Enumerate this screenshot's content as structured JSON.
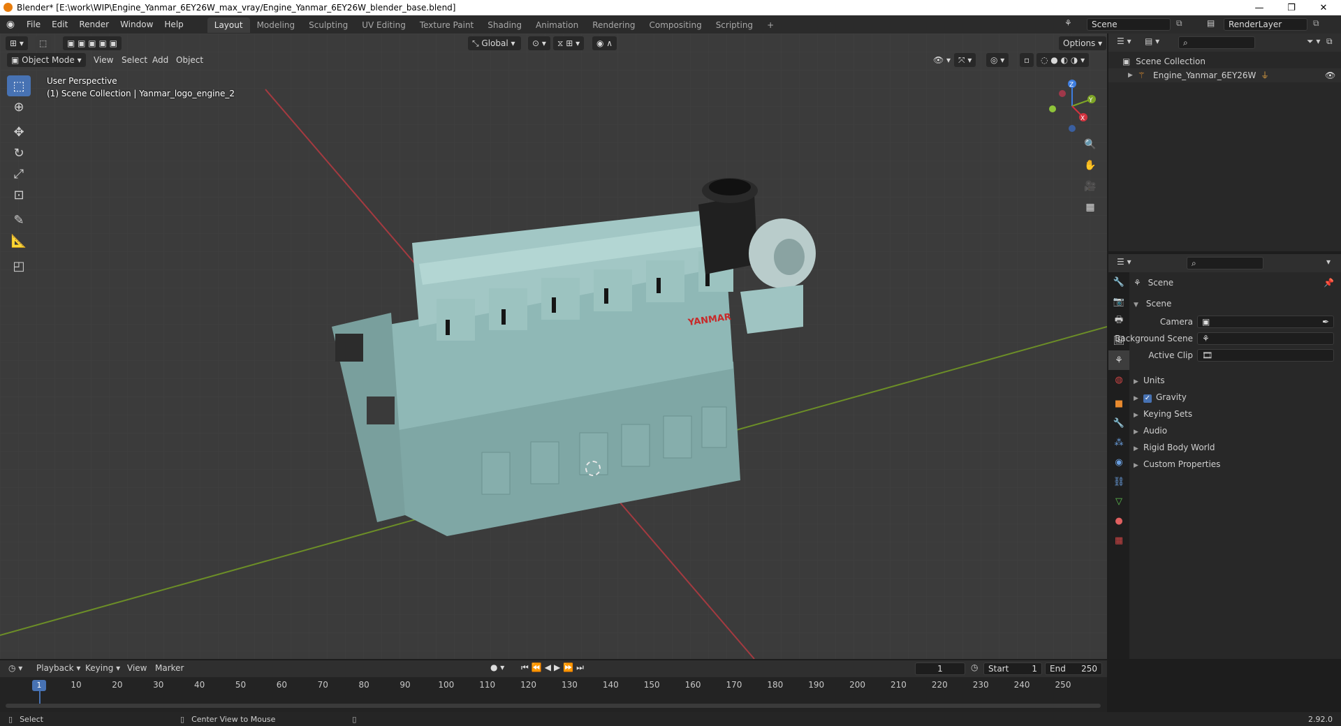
{
  "window": {
    "title": "Blender* [E:\\work\\WIP\\Engine_Yanmar_6EY26W_max_vray/Engine_Yanmar_6EY26W_blender_base.blend]",
    "minimize": "—",
    "restore": "❐",
    "close": "✕"
  },
  "menubar": {
    "items": [
      "File",
      "Edit",
      "Render",
      "Window",
      "Help"
    ],
    "workspaces": [
      "Layout",
      "Modeling",
      "Sculpting",
      "UV Editing",
      "Texture Paint",
      "Shading",
      "Animation",
      "Rendering",
      "Compositing",
      "Scripting"
    ],
    "add_workspace": "+",
    "scene": "Scene",
    "renderlayer": "RenderLayer"
  },
  "viewport": {
    "orientation": "Global",
    "options": "Options",
    "mode": "Object Mode",
    "menus": [
      "View",
      "Select",
      "Add",
      "Object"
    ],
    "overlay_title": "User Perspective",
    "overlay_sub": "(1) Scene Collection | Yanmar_logo_engine_2",
    "brand_text": "YANMAR",
    "gizmo": {
      "x": "X",
      "y": "Y",
      "z": "Z"
    }
  },
  "outliner": {
    "root": "Scene Collection",
    "items": [
      {
        "label": "Engine_Yanmar_6EY26W"
      }
    ]
  },
  "properties": {
    "header": "Scene",
    "panel": "Scene",
    "fields": [
      {
        "label": "Camera",
        "value": ""
      },
      {
        "label": "Background Scene",
        "value": ""
      },
      {
        "label": "Active Clip",
        "value": ""
      }
    ],
    "sections": [
      "Units",
      "Gravity",
      "Keying Sets",
      "Audio",
      "Rigid Body World",
      "Custom Properties"
    ],
    "gravity_checked": true
  },
  "timeline": {
    "menus": [
      "Playback",
      "Keying",
      "View",
      "Marker"
    ],
    "current_frame": "1",
    "start_label": "Start",
    "start": "1",
    "end_label": "End",
    "end": "250",
    "ticks": [
      "10",
      "20",
      "30",
      "40",
      "50",
      "60",
      "70",
      "80",
      "90",
      "100",
      "110",
      "120",
      "130",
      "140",
      "150",
      "160",
      "170",
      "180",
      "190",
      "200",
      "210",
      "220",
      "230",
      "240",
      "250"
    ]
  },
  "status": {
    "select": "Select",
    "center": "Center View to Mouse",
    "version": "2.92.0"
  },
  "colors": {
    "accent": "#4772b3",
    "engine": "#8fb8b6",
    "x_axis": "#c8323a",
    "y_axis": "#6a9a1f"
  }
}
